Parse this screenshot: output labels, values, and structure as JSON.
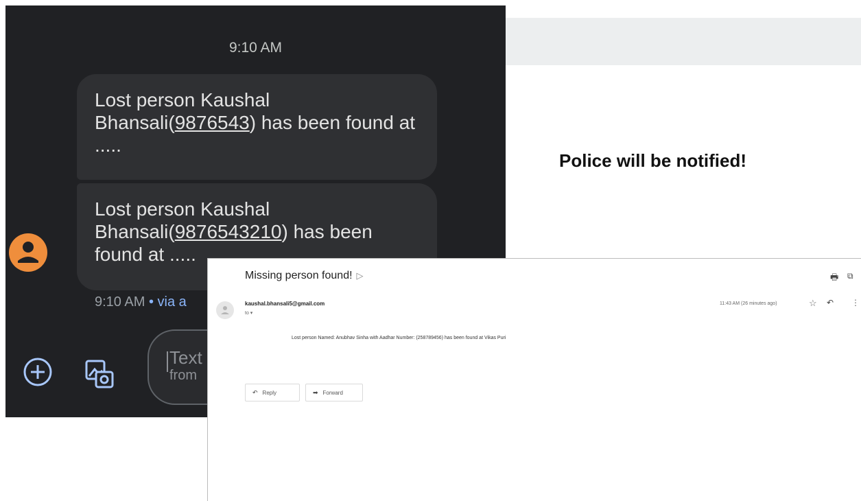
{
  "sms": {
    "time_top": "9:10 AM",
    "messages": [
      {
        "pre": "Lost person Kaushal Bhansali(",
        "number": "9876543",
        "post": ") has been found at ....."
      },
      {
        "pre": "Lost person Kaushal Bhansali(",
        "number": "9876543210",
        "post": ") has been found at ....."
      }
    ],
    "time_bottom": "9:10 AM",
    "via": " • via a",
    "compose_line1": "Text",
    "compose_line2": "from",
    "avatar_color": "#ef8e3c"
  },
  "popup": {
    "message": "Police will be notified!"
  },
  "email": {
    "subject": "Missing person found!",
    "sender": "kaushal.bhansali5@gmail.com",
    "to": "to ▾",
    "timestamp": "11:43 AM (26 minutes ago)",
    "body": "Lost person Named: Anubhav Sinha with Aadhar Number: (258789456) has been found at Vikas Puri",
    "reply_label": "Reply",
    "forward_label": "Forward"
  },
  "icons": {
    "plus": "plus-circle-icon",
    "gallery": "gallery-icon",
    "print": "print-icon",
    "new_window": "new-window-icon",
    "star": "star-icon",
    "reply": "reply-icon",
    "forward": "forward-icon",
    "more": "more-vert-icon"
  }
}
